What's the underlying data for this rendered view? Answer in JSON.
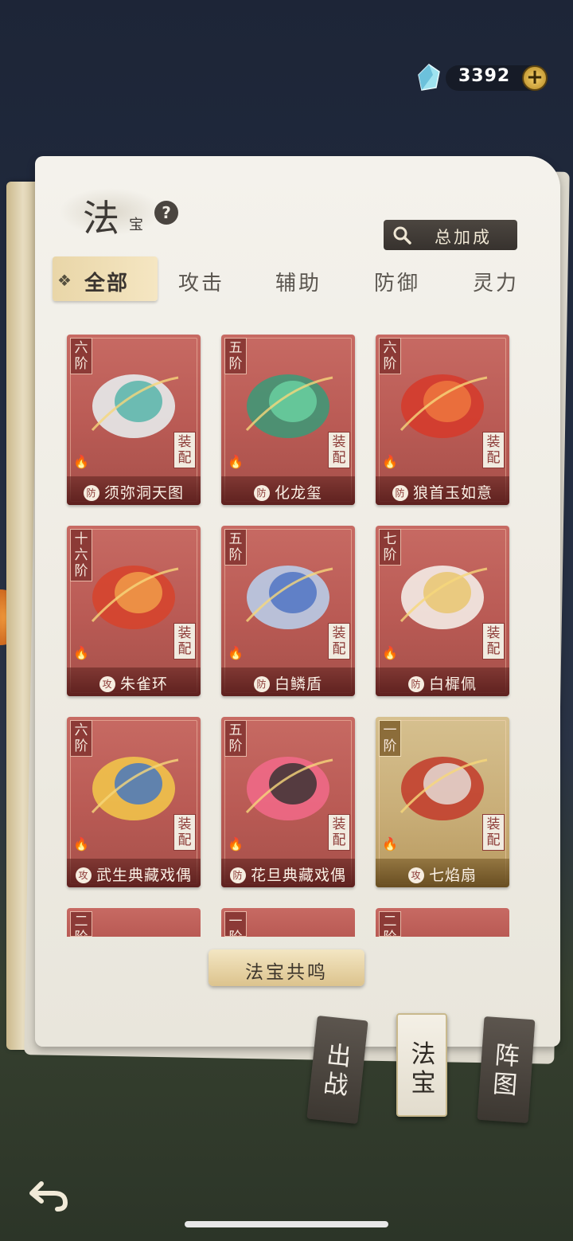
{
  "currency": {
    "value": "3392",
    "icon": "crystal-gem-icon",
    "add_label": "+"
  },
  "header": {
    "title_big": "法",
    "title_small": "宝",
    "help": "?",
    "bonus_label": "总加成"
  },
  "tabs": [
    {
      "label": "全部",
      "active": true
    },
    {
      "label": "攻击",
      "active": false
    },
    {
      "label": "辅助",
      "active": false
    },
    {
      "label": "防御",
      "active": false
    },
    {
      "label": "灵力",
      "active": false
    }
  ],
  "cards": [
    {
      "tier": "六阶",
      "equip": "装配",
      "type": "防",
      "name": "须弥洞天图",
      "rarity": "red"
    },
    {
      "tier": "五阶",
      "equip": "装配",
      "type": "防",
      "name": "化龙玺",
      "rarity": "red"
    },
    {
      "tier": "六阶",
      "equip": "装配",
      "type": "防",
      "name": "狼首玉如意",
      "rarity": "red"
    },
    {
      "tier": "十六阶",
      "equip": "装配",
      "type": "攻",
      "name": "朱雀环",
      "rarity": "red"
    },
    {
      "tier": "五阶",
      "equip": "装配",
      "type": "防",
      "name": "白鳞盾",
      "rarity": "red"
    },
    {
      "tier": "七阶",
      "equip": "装配",
      "type": "防",
      "name": "白樨佩",
      "rarity": "red"
    },
    {
      "tier": "六阶",
      "equip": "装配",
      "type": "攻",
      "name": "武生典藏戏偶",
      "rarity": "red"
    },
    {
      "tier": "五阶",
      "equip": "装配",
      "type": "防",
      "name": "花旦典藏戏偶",
      "rarity": "red"
    },
    {
      "tier": "一阶",
      "equip": "装配",
      "type": "攻",
      "name": "七焰扇",
      "rarity": "gold"
    }
  ],
  "partial_cards": [
    {
      "tier": "二阶"
    },
    {
      "tier": "一阶"
    },
    {
      "tier": "二阶"
    }
  ],
  "resonance_label": "法宝共鸣",
  "bookmarks": [
    {
      "label_top": "出",
      "label_bottom": "战",
      "active": false
    },
    {
      "label_top": "法",
      "label_bottom": "宝",
      "active": true
    },
    {
      "label_top": "阵",
      "label_bottom": "图",
      "active": false
    }
  ]
}
